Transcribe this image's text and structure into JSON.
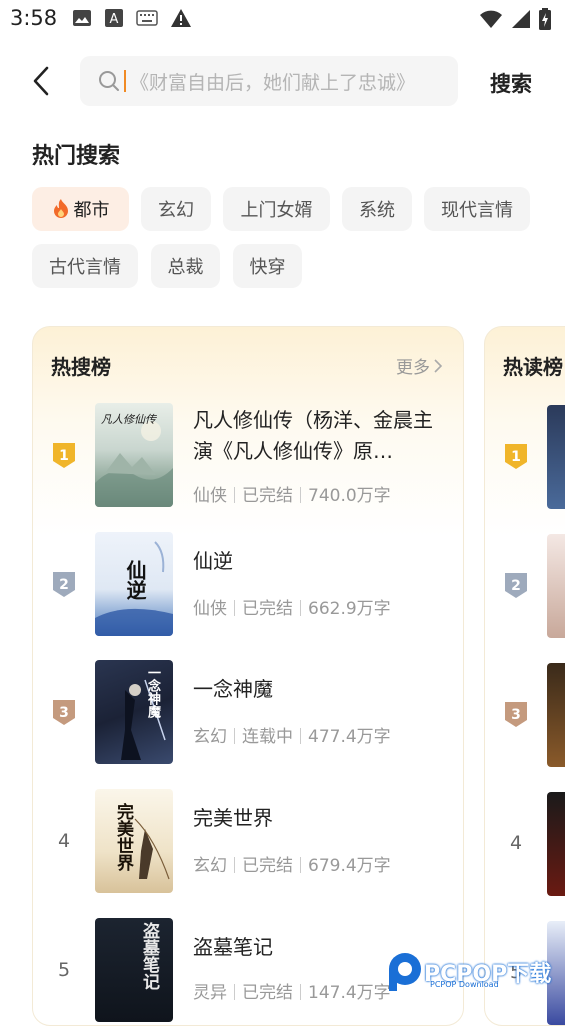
{
  "status_bar": {
    "time": "3:58"
  },
  "search": {
    "placeholder": "《财富自由后，她们献上了忠诚》",
    "button": "搜索"
  },
  "hot_search": {
    "title": "热门搜索",
    "tags": [
      "都市",
      "玄幻",
      "上门女婿",
      "系统",
      "现代言情",
      "古代言情",
      "总裁",
      "快穿"
    ]
  },
  "ranking": {
    "title": "热搜榜",
    "more": "更多",
    "items": [
      {
        "rank": "1",
        "title": "凡人修仙传（杨洋、金晨主演《凡人修仙传》原…",
        "genre": "仙侠",
        "status": "已完结",
        "words": "740.0万字",
        "cover_text": "凡人修仙传"
      },
      {
        "rank": "2",
        "title": "仙逆",
        "genre": "仙侠",
        "status": "已完结",
        "words": "662.9万字",
        "cover_text": "仙逆"
      },
      {
        "rank": "3",
        "title": "一念神魔",
        "genre": "玄幻",
        "status": "连载中",
        "words": "477.4万字",
        "cover_text": "一念神魔"
      },
      {
        "rank": "4",
        "title": "完美世界",
        "genre": "玄幻",
        "status": "已完结",
        "words": "679.4万字",
        "cover_text": "完美世界"
      },
      {
        "rank": "5",
        "title": "盗墓笔记",
        "genre": "灵异",
        "status": "已完结",
        "words": "147.4万字",
        "cover_text": "盗墓笔记"
      }
    ]
  },
  "ranking2": {
    "title": "热读榜",
    "ranks": [
      "1",
      "2",
      "3",
      "4",
      "5"
    ]
  },
  "watermark": {
    "text": "PCPOP下载",
    "sub": "PCPOP Download"
  },
  "colors": {
    "accent": "#f08a24",
    "gold": "#f0b52a",
    "silver": "#9eaabc",
    "bronze": "#c49a7e"
  }
}
